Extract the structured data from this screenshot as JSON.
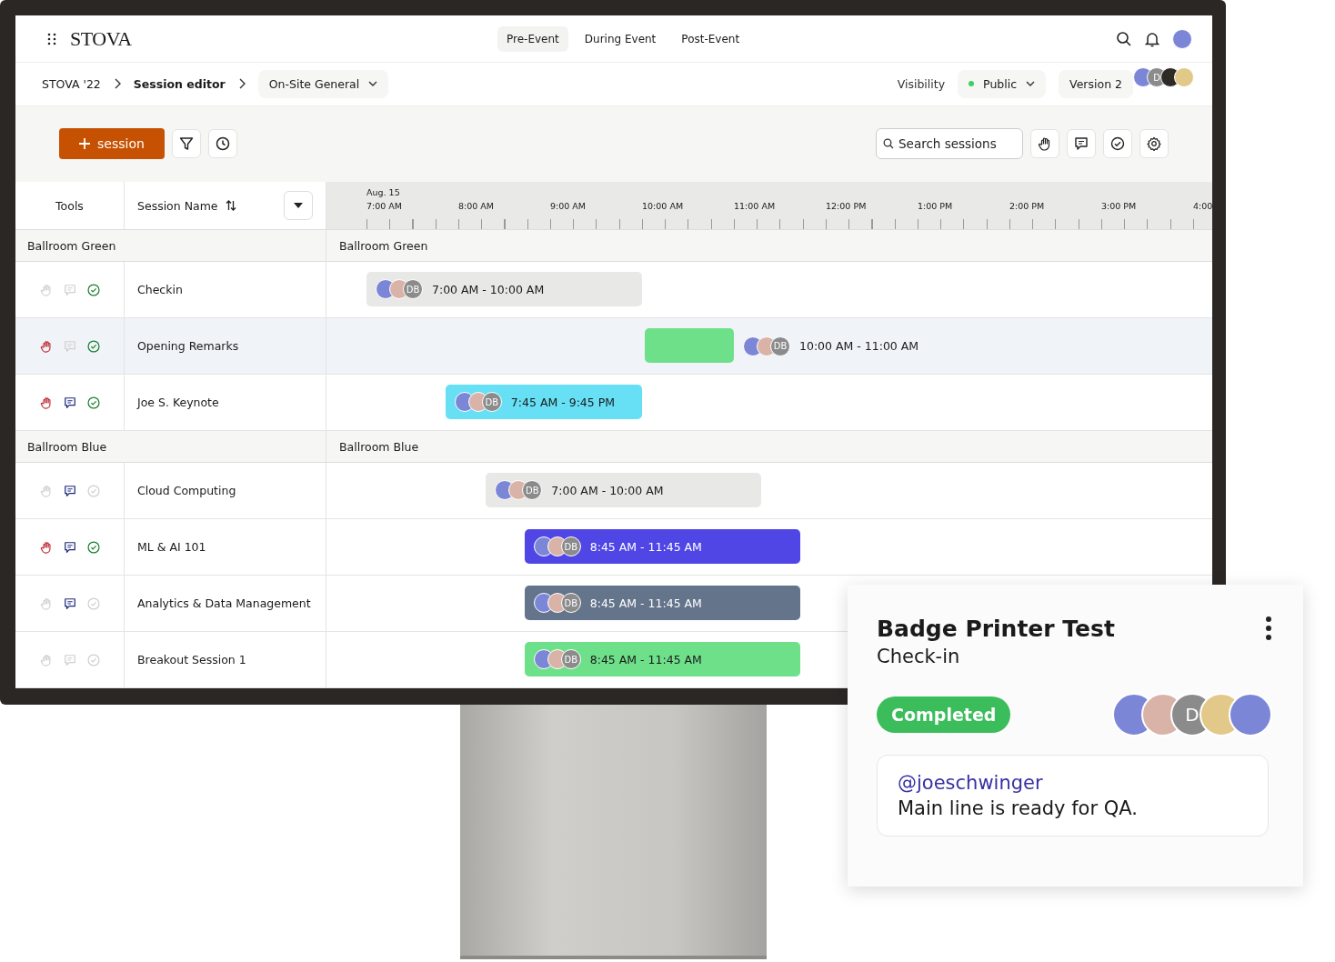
{
  "header": {
    "logo": "STOVA",
    "tabs": [
      {
        "label": "Pre-Event",
        "selected": true
      },
      {
        "label": "During Event",
        "selected": false
      },
      {
        "label": "Post-Event",
        "selected": false
      }
    ]
  },
  "breadcrumb": {
    "items": [
      {
        "label": "STOVA '22",
        "current": false
      },
      {
        "label": "Session editor",
        "current": true
      }
    ],
    "dropdown": "On-Site General",
    "visibility_label": "Visibility",
    "visibility": "Public",
    "version": "Version 2",
    "collaborators": [
      {
        "kind": "photo"
      },
      {
        "kind": "initials",
        "text": "D"
      },
      {
        "kind": "photo"
      },
      {
        "kind": "photo"
      }
    ]
  },
  "toolbar": {
    "add_button": "session",
    "search": {
      "placeholder": "Search sessions"
    }
  },
  "table": {
    "columns": [
      "Tools",
      "Session Name"
    ],
    "date": "Aug. 15",
    "hours": [
      "7:00 AM",
      "8:00 AM",
      "9:00 AM",
      "10:00 AM",
      "11:00 AM",
      "12:00 PM",
      "1:00 PM",
      "2:00 PM",
      "3:00 PM",
      "4:00"
    ],
    "groups": [
      {
        "name": "Ballroom Green",
        "timeline_label": "Ballroom Green",
        "sessions": [
          {
            "name": "Checkin",
            "selected": false,
            "raised_hand": false,
            "comments": false,
            "approved": true,
            "bar": {
              "kind": "inside",
              "color": "#e8e8e6",
              "time": "7:00 AM - 10:00 AM",
              "avatars": [
                {
                  "kind": "photo"
                },
                {
                  "kind": "photo"
                },
                {
                  "kind": "initials",
                  "text": "DB"
                }
              ]
            }
          },
          {
            "name": "Opening Remarks",
            "selected": true,
            "raised_hand": true,
            "comments": false,
            "approved": true,
            "bar": {
              "kind": "outside",
              "color": "#6ee08a",
              "time": "10:00 AM - 11:00 AM",
              "avatars": [
                {
                  "kind": "photo"
                },
                {
                  "kind": "photo"
                },
                {
                  "kind": "initials",
                  "text": "DB"
                }
              ]
            }
          },
          {
            "name": "Joe S. Keynote",
            "selected": false,
            "raised_hand": true,
            "comments": true,
            "approved": true,
            "bar": {
              "kind": "inside",
              "color": "#67e0f5",
              "time": "7:45 AM - 9:45 PM",
              "avatars": [
                {
                  "kind": "photo"
                },
                {
                  "kind": "photo"
                },
                {
                  "kind": "initials",
                  "text": "DB"
                }
              ]
            }
          }
        ]
      },
      {
        "name": "Ballroom Blue",
        "timeline_label": "Ballroom Blue",
        "sessions": [
          {
            "name": "Cloud Computing",
            "selected": false,
            "raised_hand": false,
            "comments": true,
            "approved": false,
            "bar": {
              "kind": "inside",
              "color": "#e8e8e6",
              "time": "7:00 AM - 10:00 AM",
              "avatars": [
                {
                  "kind": "photo"
                },
                {
                  "kind": "photo"
                },
                {
                  "kind": "initials",
                  "text": "DB"
                }
              ]
            }
          },
          {
            "name": "ML & AI 101",
            "selected": false,
            "raised_hand": true,
            "comments": true,
            "approved": true,
            "bar": {
              "kind": "inside",
              "color": "#4f46e5",
              "time": "8:45 AM - 11:45 AM",
              "avatars": [
                {
                  "kind": "photo"
                },
                {
                  "kind": "photo"
                },
                {
                  "kind": "initials",
                  "text": "DB"
                }
              ]
            }
          },
          {
            "name": "Analytics & Data Management",
            "selected": false,
            "raised_hand": false,
            "comments": true,
            "approved": false,
            "bar": {
              "kind": "inside",
              "color": "#64748b",
              "time": "8:45 AM - 11:45 AM",
              "avatars": [
                {
                  "kind": "photo"
                },
                {
                  "kind": "photo"
                },
                {
                  "kind": "initials",
                  "text": "DB"
                }
              ]
            }
          },
          {
            "name": "Breakout Session 1",
            "selected": false,
            "raised_hand": false,
            "comments": false,
            "approved": false,
            "bar": {
              "kind": "inside",
              "color": "#6ee08a",
              "time": "8:45 AM - 11:45 AM",
              "avatars": [
                {
                  "kind": "photo"
                },
                {
                  "kind": "photo"
                },
                {
                  "kind": "initials",
                  "text": "DB"
                }
              ]
            }
          }
        ]
      }
    ]
  },
  "card": {
    "title": "Badge Printer Test",
    "subtitle": "Check-in",
    "status": "Completed",
    "avatars": [
      {
        "kind": "photo"
      },
      {
        "kind": "photo"
      },
      {
        "kind": "initials",
        "text": "D"
      },
      {
        "kind": "photo"
      },
      {
        "kind": "photo"
      }
    ],
    "comment": {
      "mention": "@joeschwinger",
      "text": "Main line is ready for QA."
    }
  }
}
